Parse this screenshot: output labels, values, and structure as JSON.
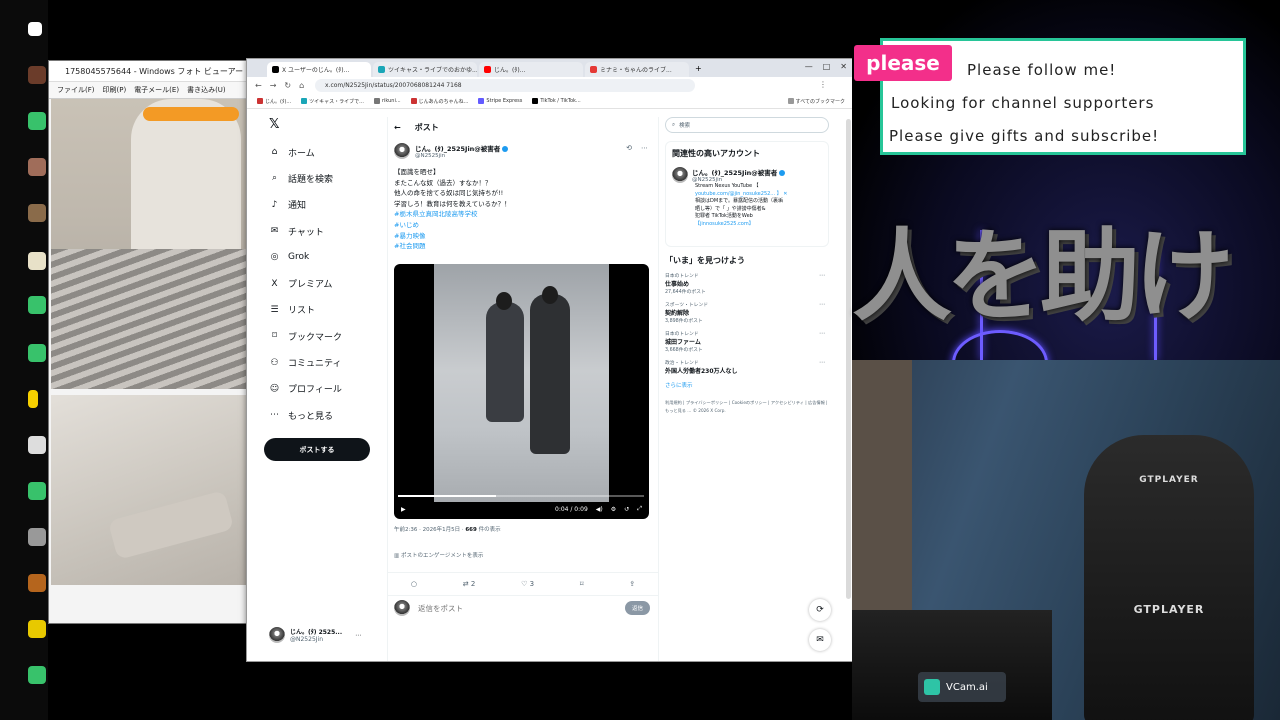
{
  "photo_viewer": {
    "title": "1758045575644 - Windows フォト ビューアー",
    "menu": [
      "ファイル(F)",
      "印刷(P)",
      "電子メール(E)",
      "書き込み(U)"
    ]
  },
  "browser": {
    "tabs": [
      {
        "label": "X ユーザーのじん。(ﾀ)...",
        "color": "#000000"
      },
      {
        "label": "ツイキャス・ライブでのおかゆ...",
        "color": "#1aa6b7"
      },
      {
        "label": "じん。(ﾀ)...",
        "color": "#ff0000"
      },
      {
        "label": "ミナミ・ちゃんのライブ...",
        "color": "#e53935"
      }
    ],
    "new_tab": "+",
    "window_controls": [
      "—",
      "□",
      "✕"
    ],
    "url": "x.com/N2525Jin/status/2007068081244 7168",
    "bookmarks": [
      "じん。(ﾀ)...",
      "ツイキャス・ライブで...",
      "rikuni...",
      "じんあんのちゃんね...",
      "Stripe Express",
      "TikTok / TikTok...",
      "すべてのブックマーク"
    ]
  },
  "x_nav": {
    "items": [
      {
        "icon": "⌂",
        "label": "ホーム",
        "name": "home"
      },
      {
        "icon": "⌕",
        "label": "話題を検索",
        "name": "explore"
      },
      {
        "icon": "🔔",
        "label": "通知",
        "name": "notifications"
      },
      {
        "icon": "✉",
        "label": "チャット",
        "name": "chat"
      },
      {
        "icon": "◎",
        "label": "Grok",
        "name": "grok"
      },
      {
        "icon": "X",
        "label": "プレミアム",
        "name": "premium"
      },
      {
        "icon": "☰",
        "label": "リスト",
        "name": "lists"
      },
      {
        "icon": "⌑",
        "label": "ブックマーク",
        "name": "bookmarks"
      },
      {
        "icon": "⚇",
        "label": "コミュニティ",
        "name": "communities"
      },
      {
        "icon": "☺",
        "label": "プロフィール",
        "name": "profile"
      },
      {
        "icon": "⋯",
        "label": "もっと見る",
        "name": "more"
      }
    ],
    "post_button": "ポストする",
    "profile_name": "じん。(ﾀ) 2525...",
    "profile_handle": "@N2525Jin"
  },
  "post": {
    "header": "ポスト",
    "author_name": "じん。(ﾀ)_2525Jin@被害者",
    "author_handle": "@N2525jin",
    "lines": [
      "【面識を晒せ】",
      "またこんな奴（過去）すなか！？",
      "他人の命を捨てる奴は同じ気持ちが!!",
      "学習しろ！教育は何を教えているか？！",
      "#栃木県立真岡北陵高等学校",
      "#いじめ",
      "#暴力映像",
      "#社会問題"
    ],
    "video_time": "0:04 / 0:09",
    "timestamp": "午前2:36 · 2026年1月5日 · ",
    "views": "669",
    "views_label": " 件の表示",
    "engagement_link": "ポストのエンゲージメントを表示",
    "actions": {
      "reply": "",
      "repost": "2",
      "like": "3"
    },
    "reply_placeholder": "返信をポスト",
    "reply_button": "返信"
  },
  "sidebar": {
    "search_placeholder": "検索",
    "related_title": "関連性の高いアカウント",
    "related_account": {
      "name": "じん。(ﾀ)_2525Jin@被害者",
      "handle": "@N2525jin",
      "bio": [
        "Stream Nexus YouTube 【",
        "youtube.com/@jin_nosuke252... 】 ✕",
        "相談はDMまで。暴露配信の活動（裏垢",
        "晒し等）で「 」や誹謗中傷者&",
        "犯罪者 TikTok活動をWeb ",
        "【jinnosuke2525.com】"
      ]
    },
    "trends_title": "「いま」を見つけよう",
    "trends": [
      {
        "category": "日本のトレンド",
        "name": "仕事始め",
        "count": "27,644件のポスト"
      },
      {
        "category": "スポーツ・トレンド",
        "name": "契約解除",
        "count": "3,898件のポスト"
      },
      {
        "category": "日本のトレンド",
        "name": "城田ファーム",
        "count": "3,668件のポスト"
      },
      {
        "category": "政治・トレンド",
        "name": "外国人労働者230万人なし",
        "count": ""
      }
    ],
    "show_more": "さらに表示",
    "footer": "利用規約 | プライバシーポリシー | Cookieのポリシー | アクセシビリティ | 広告情報 | もっと見る … © 2026 X Corp."
  },
  "overlay": {
    "please": "please",
    "lines": [
      "Please follow me!",
      "Looking for channel supporters",
      "Please give gifts and subscribe!"
    ],
    "big_text": "人を助ける",
    "chair_brand": "GTPLAYER",
    "watermark": "VCam.ai",
    "accent": "#27c598",
    "pink": "#f32f8a"
  }
}
